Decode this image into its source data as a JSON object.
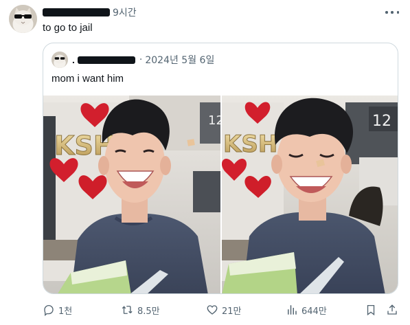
{
  "tweet": {
    "time": "9시간",
    "text": "to go to jail"
  },
  "quote": {
    "prefix": ".",
    "date_sep": "·",
    "date": "2024년 5월 6일",
    "text": "mom i want him",
    "media": [
      {
        "sign_text": "KSH",
        "truck_number": "12"
      },
      {
        "sign_text": "KSH",
        "truck_number": "12"
      }
    ]
  },
  "actions": {
    "reply_count": "1천",
    "retweet_count": "8.5만",
    "like_count": "21만",
    "view_count": "644만"
  },
  "icons": {
    "more": "more-dots-icon",
    "reply": "reply-bubble-icon",
    "retweet": "retweet-icon",
    "like": "heart-icon",
    "views": "views-bar-chart-icon",
    "bookmark": "bookmark-icon",
    "share": "share-upload-icon"
  },
  "colors": {
    "text": "#0f1419",
    "secondary": "#536471",
    "border": "#cfd9de"
  }
}
